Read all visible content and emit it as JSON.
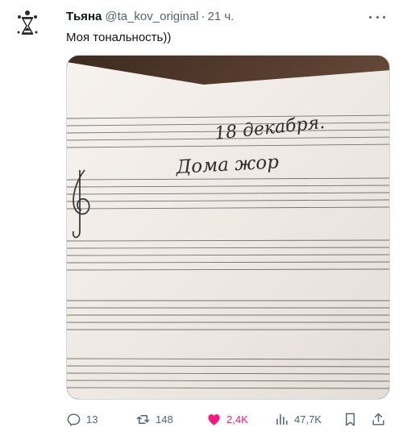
{
  "author": {
    "name": "Тьяна",
    "handle": "@ta_kov_original",
    "separator": "·",
    "time": "21 ч."
  },
  "tweet": {
    "text": "Моя тональность))"
  },
  "media": {
    "handwriting_line1": "18 декабря.",
    "handwriting_line2": "Дома жор"
  },
  "actions": {
    "replies": "13",
    "retweets": "148",
    "likes": "2,4K",
    "views": "47,7K"
  },
  "colors": {
    "text_primary": "#0f1419",
    "text_secondary": "#536471",
    "like_active": "#f91880",
    "border": "#cfd9de"
  },
  "icons": {
    "avatar": "hourglass-avatar",
    "more": "more-dots-icon",
    "reply": "reply-icon",
    "retweet": "retweet-icon",
    "like": "heart-filled-icon",
    "views": "views-chart-icon",
    "bookmark": "bookmark-icon",
    "share": "share-icon"
  }
}
